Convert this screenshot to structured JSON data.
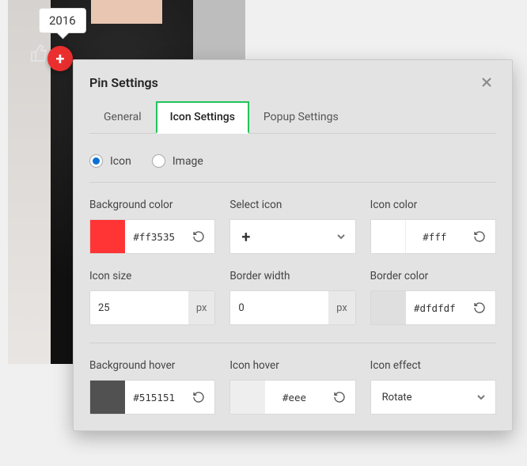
{
  "background": {
    "tooltip_year": "2016"
  },
  "modal": {
    "title": "Pin Settings",
    "tabs": {
      "general": "General",
      "icon_settings": "Icon Settings",
      "popup_settings": "Popup Settings",
      "active": "icon_settings"
    },
    "type_radio": {
      "icon": "Icon",
      "image": "Image",
      "selected": "icon"
    },
    "fields": {
      "background_color": {
        "label": "Background color",
        "value": "#ff3535"
      },
      "select_icon": {
        "label": "Select icon",
        "icon": "plus-icon"
      },
      "icon_color": {
        "label": "Icon color",
        "value": "#fff"
      },
      "icon_size": {
        "label": "Icon size",
        "value": "25",
        "unit": "px"
      },
      "border_width": {
        "label": "Border width",
        "value": "0",
        "unit": "px"
      },
      "border_color": {
        "label": "Border color",
        "value": "#dfdfdf"
      },
      "background_hover": {
        "label": "Background hover",
        "value": "#515151"
      },
      "icon_hover": {
        "label": "Icon hover",
        "value": "#eee"
      },
      "icon_effect": {
        "label": "Icon effect",
        "value": "Rotate"
      }
    },
    "colors": {
      "accent_green": "#21c45a",
      "pin_red": "#eb2f2f",
      "radio_blue": "#0b71d6"
    }
  }
}
